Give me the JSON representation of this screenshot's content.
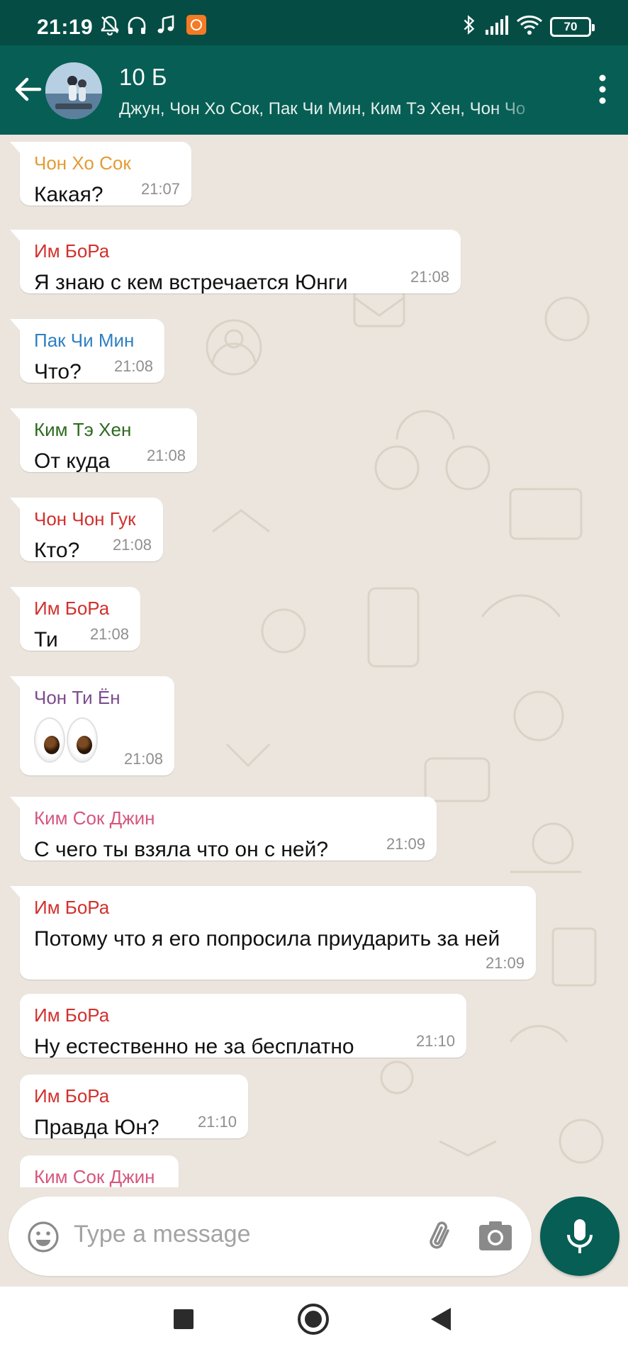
{
  "statusbar": {
    "time": "21:19",
    "battery": "70",
    "icons": [
      "bell-off-icon",
      "headphones-icon",
      "music-note-icon",
      "app-notification-icon",
      "bluetooth-icon",
      "signal-icon",
      "wifi-icon",
      "battery-icon"
    ]
  },
  "header": {
    "title": "10 Б",
    "subtitle": "Джун, Чон Хо Сок, Пак Чи Мин, Ким Тэ Хен, Чон Чо",
    "back_icon": "arrow-left-icon",
    "menu_icon": "more-vert-icon"
  },
  "colors": {
    "header": "#075e54",
    "statusbar": "#054d44",
    "accent": "#075e54",
    "chat_bg": "#ece5dd"
  },
  "messages": [
    {
      "sender": "Чон Хо Сок",
      "color": "#e39b35",
      "text": "Какая?",
      "time": "21:07"
    },
    {
      "sender": "Им БоРа",
      "color": "#d0312d",
      "text": "Я знаю с кем встречается Юнги",
      "time": "21:08"
    },
    {
      "sender": "Пак Чи Мин",
      "color": "#2e7fc1",
      "text": "Что?",
      "time": "21:08"
    },
    {
      "sender": "Ким Тэ Хен",
      "color": "#2d6a1e",
      "text": "От куда",
      "time": "21:08"
    },
    {
      "sender": "Чон Чон Гук",
      "color": "#d0312d",
      "text": "Кто?",
      "time": "21:08"
    },
    {
      "sender": "Им БоРа",
      "color": "#d0312d",
      "text": "Ти",
      "time": "21:08"
    },
    {
      "sender": "Чон Ти Ён",
      "color": "#7d4b8f",
      "text": "👀",
      "time": "21:08"
    },
    {
      "sender": "Ким Сок Джин",
      "color": "#d6567e",
      "text": "С чего ты взяла что он с ней?",
      "time": "21:09"
    },
    {
      "sender": "Им БоРа",
      "color": "#d0312d",
      "text": "Потому что я его попросила приударить за ней",
      "time": "21:09"
    },
    {
      "sender": "Им БоРа",
      "color": "#d0312d",
      "text": "Ну естественно не за бесплатно",
      "time": "21:10"
    },
    {
      "sender": "Им БоРа",
      "color": "#d0312d",
      "text": "Правда Юн?",
      "time": "21:10"
    },
    {
      "sender": "Ким Сок Джин",
      "color": "#d6567e",
      "text": "",
      "time": ""
    }
  ],
  "input": {
    "placeholder": "Type a message",
    "emoji_icon": "emoji-icon",
    "attach_icon": "paperclip-icon",
    "camera_icon": "camera-icon",
    "mic_icon": "microphone-icon"
  },
  "navbar": {
    "icons": [
      "recents-square-icon",
      "home-circle-icon",
      "back-triangle-icon"
    ]
  }
}
